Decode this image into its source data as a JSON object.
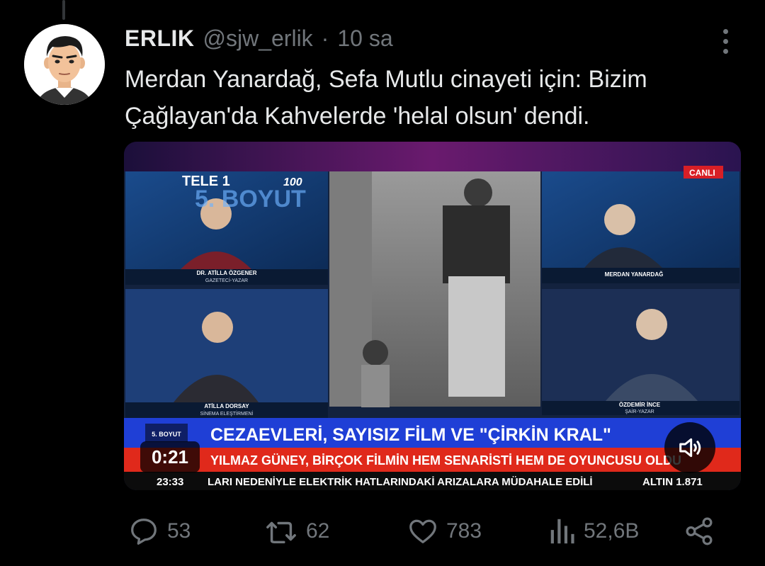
{
  "tweet": {
    "author": {
      "name": "ERLIK",
      "handle": "@sjw_erlik",
      "separator": "·",
      "time": "10 sa"
    },
    "text_line1": "Merdan Yanardağ, Sefa Mutlu cinayeti için: Bizim",
    "text_line2": "Çağlayan'da Kahvelerde 'helal olsun' dendi.",
    "media": {
      "duration": "0:21",
      "channel": "TELE 1",
      "channel_badge": "100",
      "live_label": "CANLI",
      "show_name": "5. BOYUT",
      "panel_names": {
        "top_left": "DR. ATİLLA ÖZGENER",
        "top_left_sub": "GAZETECİ-YAZAR",
        "bottom_left": "ATİLLA DORSAY",
        "bottom_left_sub": "SİNEMA ELEŞTİRMENİ",
        "top_right": "MERDAN YANARDAĞ",
        "bottom_right": "ÖZDEMİR İNCE",
        "bottom_right_sub": "ŞAİR-YAZAR"
      },
      "lower_third_tag": "5. BOYUT",
      "headline": "CEZAEVLERİ, SAYISIZ FİLM VE \"ÇİRKİN KRAL\"",
      "subline": "YILMAZ GÜNEY, BİRÇOK FİLMİN HEM SENARİSTİ HEM DE OYUNCUSU OLDU",
      "ticker_time": "23:33",
      "ticker_text": "LARI NEDENİYLE ELEKTRİK HATLARINDAKİ ARIZALARA MÜDAHALE EDİLİ",
      "ticker_extra": "ALTIN 1.871"
    },
    "stats": {
      "replies": "53",
      "reposts": "62",
      "likes": "783",
      "views": "52,6B"
    }
  },
  "icons": {
    "reply": "reply-icon",
    "repost": "repost-icon",
    "like": "heart-icon",
    "views": "views-icon",
    "share": "share-icon",
    "volume": "volume-icon",
    "more": "more-icon"
  },
  "colors": {
    "background": "#000000",
    "text": "#e7e9ea",
    "muted": "#71767b",
    "headline_bar": "#1f3fd6",
    "subline_bar": "#e0291b"
  }
}
